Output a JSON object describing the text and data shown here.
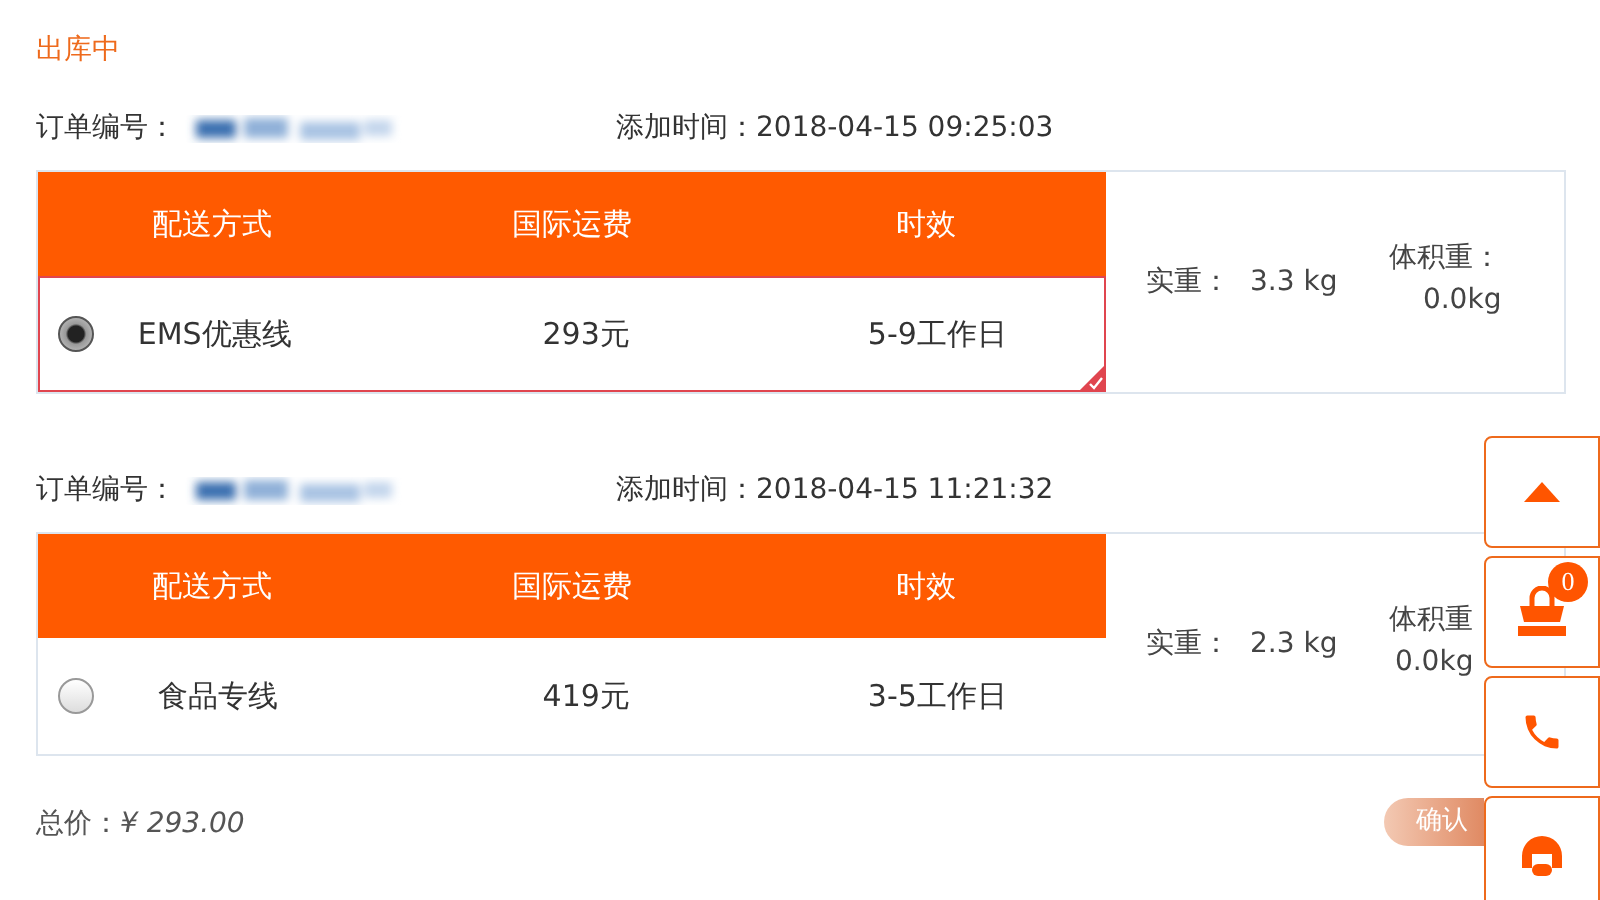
{
  "status": "出库中",
  "orders": [
    {
      "order_label": "订单编号：",
      "time_label": "添加时间：",
      "time": "2018-04-15 09:25:03",
      "columns": [
        "配送方式",
        "国际运费",
        "时效"
      ],
      "row": {
        "selected": true,
        "method": "EMS优惠线",
        "fee": "293元",
        "duration": "5-9工作日"
      },
      "weight_label": "实重：",
      "weight": "3.3 kg",
      "volume_label": "体积重：",
      "volume": "0.0kg"
    },
    {
      "order_label": "订单编号：",
      "time_label": "添加时间：",
      "time": "2018-04-15 11:21:32",
      "columns": [
        "配送方式",
        "国际运费",
        "时效"
      ],
      "row": {
        "selected": false,
        "method": "食品专线",
        "fee": "419元",
        "duration": "3-5工作日"
      },
      "weight_label": "实重：",
      "weight": "2.3 kg",
      "volume_label": "体积重",
      "volume": "0.0kg"
    }
  ],
  "total": {
    "label": "总价：",
    "value": "¥ 293.00"
  },
  "confirm_button": "确认",
  "side_buttons": [
    {
      "kind": "top"
    },
    {
      "kind": "cart",
      "badge": "0"
    },
    {
      "kind": "phone"
    },
    {
      "kind": "service"
    }
  ]
}
